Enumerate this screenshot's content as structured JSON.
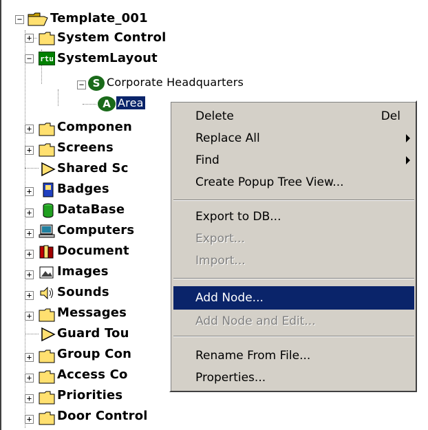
{
  "tree": {
    "root": "Template_001",
    "items": {
      "system_control": "System Control",
      "system_layout": "SystemLayout",
      "corporate_hq": "Corporate Headquarters",
      "area": "Area",
      "components": "Componen",
      "screens": "Screens",
      "shared_screens": "Shared Sc",
      "badges": "Badges",
      "database": "DataBase",
      "computers": "Computers",
      "documentation": "Document",
      "images": "Images",
      "sounds": "Sounds",
      "messages": "Messages",
      "guard_tour": "Guard Tou",
      "group_control": "Group Con",
      "access_control": "Access Co",
      "priorities": "Priorities",
      "door_control": "Door Control"
    },
    "badge_rtu": "rtu",
    "badge_s": "S",
    "badge_a": "A",
    "expander_plus": "+",
    "expander_minus": "−"
  },
  "context_menu": {
    "delete": "Delete",
    "delete_shortcut": "Del",
    "replace_all": "Replace All",
    "find": "Find",
    "create_popup": "Create Popup Tree View...",
    "export_db": "Export to DB...",
    "export": "Export...",
    "import": "Import...",
    "add_node": "Add Node...",
    "add_node_edit": "Add Node and Edit...",
    "rename_from_file": "Rename From File...",
    "properties": "Properties..."
  },
  "colors": {
    "selection": "#0a246a",
    "menu_bg": "#d4d0c8",
    "folder": "#ffe070",
    "disabled_text": "#808080"
  }
}
